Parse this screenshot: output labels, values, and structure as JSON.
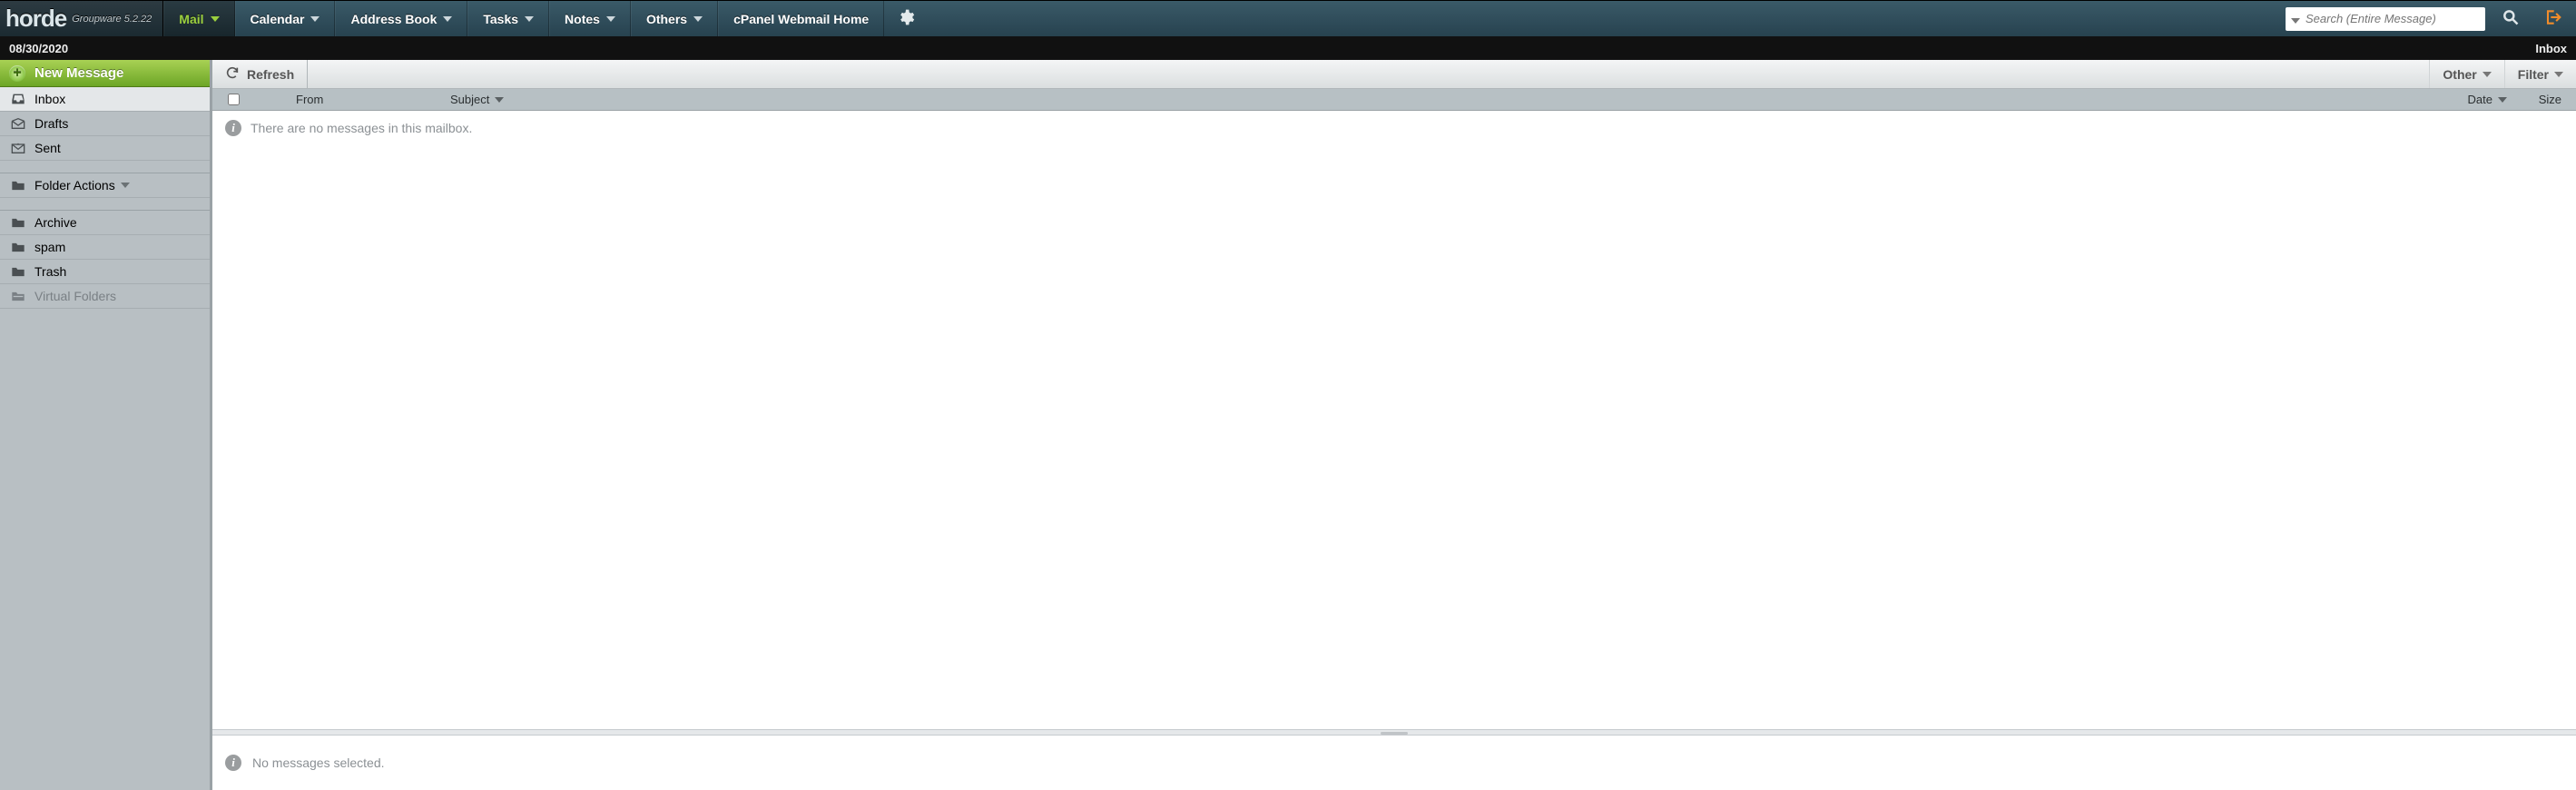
{
  "brand": {
    "name": "horde",
    "tagline": "Groupware 5.2.22"
  },
  "nav": {
    "items": [
      {
        "label": "Mail",
        "active": true,
        "dropdown": true
      },
      {
        "label": "Calendar",
        "dropdown": true
      },
      {
        "label": "Address Book",
        "dropdown": true
      },
      {
        "label": "Tasks",
        "dropdown": true
      },
      {
        "label": "Notes",
        "dropdown": true
      },
      {
        "label": "Others",
        "dropdown": true
      },
      {
        "label": "cPanel Webmail Home",
        "dropdown": false
      }
    ]
  },
  "search": {
    "placeholder": "Search (Entire Message)"
  },
  "datebar": {
    "date": "08/30/2020",
    "location": "Inbox"
  },
  "sidebar": {
    "new_message": "New Message",
    "mailboxes": [
      {
        "label": "Inbox",
        "icon": "inbox",
        "selected": true
      },
      {
        "label": "Drafts",
        "icon": "drafts"
      },
      {
        "label": "Sent",
        "icon": "sent"
      }
    ],
    "folder_actions_label": "Folder Actions",
    "folders": [
      {
        "label": "Archive",
        "icon": "folder"
      },
      {
        "label": "spam",
        "icon": "folder"
      },
      {
        "label": "Trash",
        "icon": "folder"
      },
      {
        "label": "Virtual Folders",
        "icon": "vfolder",
        "muted": true
      }
    ]
  },
  "toolbar": {
    "refresh": "Refresh",
    "other": "Other",
    "filter": "Filter"
  },
  "columns": {
    "from": "From",
    "subject": "Subject",
    "date": "Date",
    "size": "Size"
  },
  "messages": {
    "empty": "There are no messages in this mailbox."
  },
  "preview": {
    "none_selected": "No messages selected."
  }
}
